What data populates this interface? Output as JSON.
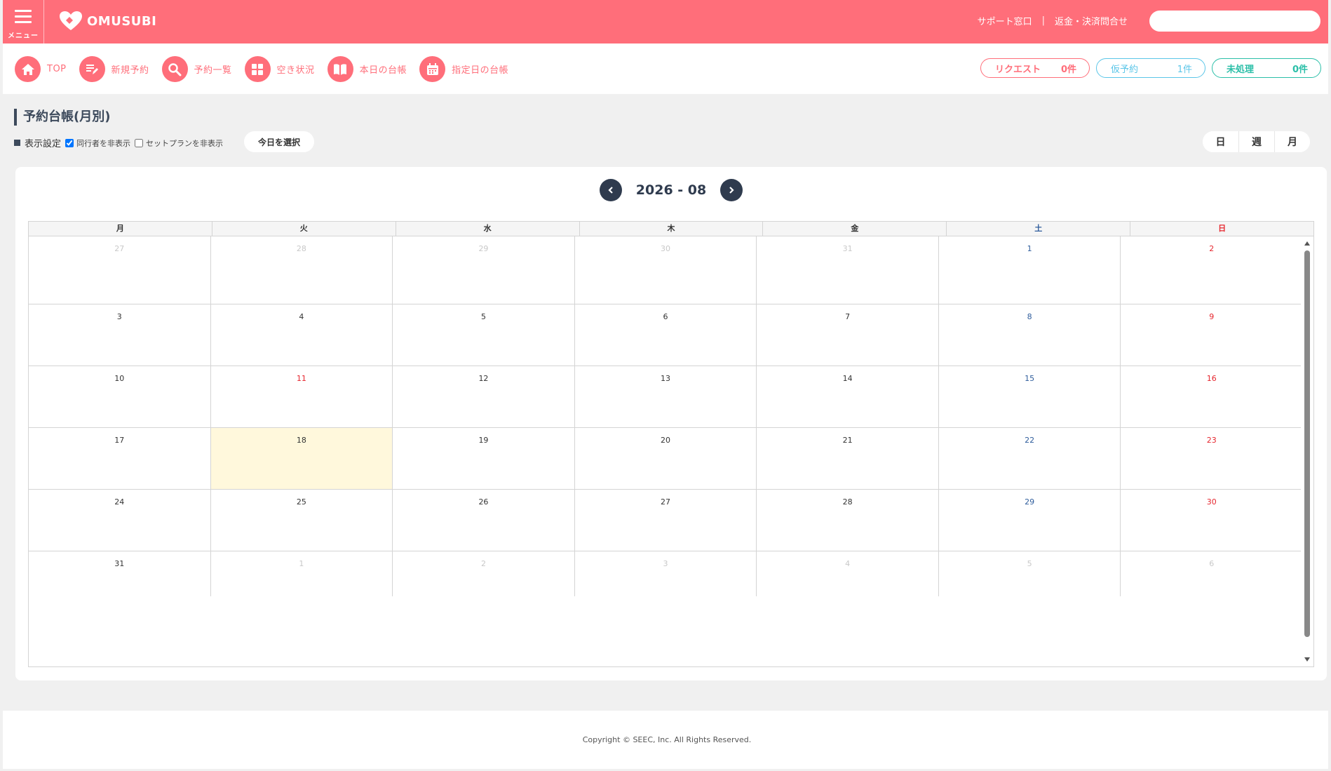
{
  "header": {
    "menu_label": "メニュー",
    "logo_text": "OMUSUBI",
    "support_link": "サポート窓口",
    "refund_link": "返金・決済問合せ",
    "search_placeholder": "",
    "brand_color": "#ff6e7a"
  },
  "nav": [
    {
      "label": "TOP",
      "icon": "home-icon"
    },
    {
      "label": "新規予約",
      "icon": "edit-icon"
    },
    {
      "label": "予約一覧",
      "icon": "search-icon"
    },
    {
      "label": "空き状況",
      "icon": "grid-icon"
    },
    {
      "label": "本日の台帳",
      "icon": "book-icon"
    },
    {
      "label": "指定日の台帳",
      "icon": "calendar-icon"
    }
  ],
  "badges": {
    "request": {
      "label": "リクエスト",
      "count": "0件"
    },
    "tentative": {
      "label": "仮予約",
      "count": "1件"
    },
    "pending": {
      "label": "未処理",
      "count": "0件"
    }
  },
  "page": {
    "title": "予約台帳(月別)",
    "settings_label": "表示設定",
    "hide_companions": "同行者を非表示",
    "hide_companions_checked": true,
    "hide_setplan": "セットプランを非表示",
    "hide_setplan_checked": false,
    "today_button": "今日を選択",
    "view_day": "日",
    "view_week": "週",
    "view_month": "月"
  },
  "calendar": {
    "month_label": "2026 - 08",
    "weekdays": [
      "月",
      "火",
      "水",
      "木",
      "金",
      "土",
      "日"
    ],
    "weeks": [
      [
        {
          "d": "27",
          "t": "other"
        },
        {
          "d": "28",
          "t": "other"
        },
        {
          "d": "29",
          "t": "other"
        },
        {
          "d": "30",
          "t": "other"
        },
        {
          "d": "31",
          "t": "other"
        },
        {
          "d": "1",
          "t": "sat"
        },
        {
          "d": "2",
          "t": "sun"
        }
      ],
      [
        {
          "d": "3"
        },
        {
          "d": "4"
        },
        {
          "d": "5"
        },
        {
          "d": "6"
        },
        {
          "d": "7"
        },
        {
          "d": "8",
          "t": "sat"
        },
        {
          "d": "9",
          "t": "sun"
        }
      ],
      [
        {
          "d": "10"
        },
        {
          "d": "11",
          "t": "hol"
        },
        {
          "d": "12"
        },
        {
          "d": "13"
        },
        {
          "d": "14"
        },
        {
          "d": "15",
          "t": "sat"
        },
        {
          "d": "16",
          "t": "sun"
        }
      ],
      [
        {
          "d": "17"
        },
        {
          "d": "18",
          "t": "today"
        },
        {
          "d": "19"
        },
        {
          "d": "20"
        },
        {
          "d": "21"
        },
        {
          "d": "22",
          "t": "sat"
        },
        {
          "d": "23",
          "t": "sun"
        }
      ],
      [
        {
          "d": "24"
        },
        {
          "d": "25"
        },
        {
          "d": "26"
        },
        {
          "d": "27"
        },
        {
          "d": "28"
        },
        {
          "d": "29",
          "t": "sat"
        },
        {
          "d": "30",
          "t": "sun"
        }
      ],
      [
        {
          "d": "31"
        },
        {
          "d": "1",
          "t": "other"
        },
        {
          "d": "2",
          "t": "other"
        },
        {
          "d": "3",
          "t": "other"
        },
        {
          "d": "4",
          "t": "other"
        },
        {
          "d": "5",
          "t": "other"
        },
        {
          "d": "6",
          "t": "other"
        }
      ]
    ]
  },
  "footer": {
    "copyright": "Copyright © SEEC, Inc. All Rights Reserved."
  }
}
